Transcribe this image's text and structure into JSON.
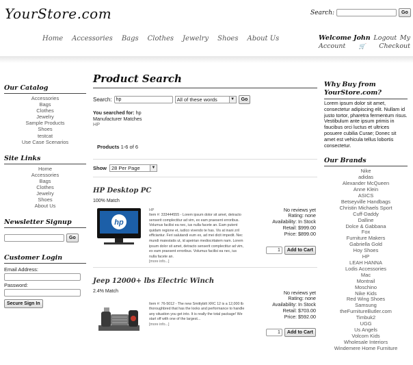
{
  "header": {
    "logo": "YourStore.com",
    "search_label": "Search:",
    "search_value": "",
    "go": "Go",
    "nav": [
      "Home",
      "Accessories",
      "Bags",
      "Clothes",
      "Jewelry",
      "Shoes",
      "About Us"
    ],
    "welcome": "Welcome John",
    "logout": "Logout",
    "my": "My",
    "account": "Account",
    "checkout": "Checkout"
  },
  "catalog": {
    "title": "Our Catalog",
    "items": [
      "Accessories",
      "Bags",
      "Clothes",
      "Jewelry",
      "Sample Products",
      "Shoes",
      "testcat",
      "Use Case Scenarios"
    ]
  },
  "sitelinks": {
    "title": "Site Links",
    "items": [
      "Home",
      "Accessories",
      "Bags",
      "Clothes",
      "Jewelry",
      "Shoes",
      "About Us"
    ]
  },
  "newsletter": {
    "title": "Newsletter Signup",
    "go": "Go"
  },
  "login": {
    "title": "Customer Login",
    "email_label": "Email Address:",
    "password_label": "Password:",
    "button": "Secure Sign In"
  },
  "main": {
    "title": "Product Search",
    "search_label": "Search:",
    "search_value": "hp",
    "mode": "All of these words",
    "go": "Go",
    "searched_label": "You searched for:",
    "searched_value": "hp",
    "manufacturer_label": "Manufacturer Matches",
    "manufacturer_value": "HP",
    "products_label": "Products",
    "products_range": "1-6 of 6",
    "show_label": "Show",
    "per_page": "28 Per Page"
  },
  "products": [
    {
      "name": "HP Desktop PC",
      "match": "100% Match",
      "brand": "HP",
      "desc": "Item #: 333444555 - Lorem ipsum dolor sit amet, detracto senserit complectitur ad vim, ex eam praesent erroribus. Volumus facilisi ea nec, ius nulla facete an. Eam putent quidam regione et, iudico vivendo te has. Vis at inani zril efficiantur. Feri salutandi eum ex, ad mei dicit impedit. Nec mundi maiestatis ut, id apeirian mediocritatem nam. Lorem ipsum dolor sit amet, detracto senserit complectitur ad vim, ex eam praesent erroribus. Volumus facilisi ea nec, ius nulla facete an.",
      "more": "[more info...]",
      "reviews": "No reviews yet",
      "rating": "Rating: none",
      "availability": "Availability: In Stock",
      "retail": "Retail: $999.00",
      "price": "Price: $899.00",
      "qty": "1",
      "add": "Add to Cart"
    },
    {
      "name": "Jeep 12000+ lbs Electric Winch",
      "match": "2.4% Match",
      "brand": "",
      "desc": "Item #: 76-5012 - The new Smittybilt XRC 12 is a 12,000 lb thoroughbred that has the looks and performance to handle any situation you get into. It is really the total package! We start off with one of the largest...",
      "more": "[more info...]",
      "reviews": "No reviews yet",
      "rating": "Rating: none",
      "availability": "Availability: In Stock",
      "retail": "Retail: $703.00",
      "price": "Price: $592.00",
      "qty": "1",
      "add": "Add to Cart"
    }
  ],
  "whybuy": {
    "title": "Why Buy from YourStore.com?",
    "text": "Lorem ipsum dolor sit amet, consectetur adipiscing elit. Nullam id justo tortor, pharetra fermentum risus. Vestibulum ante ipsum primis in faucibus orci luctus et ultrices posuere cubilia Curae; Donec sit amet est vehicula tellus lobortis consectetur."
  },
  "brands": {
    "title": "Our Brands",
    "items": [
      "Nike",
      "adidas",
      "Alexander McQueen",
      "Anne Klein",
      "ASICS",
      "Betseyville Handbags",
      "Christin Michaels Sport",
      "Cuff-Daddy",
      "Dalline",
      "Dolce & Gabbana",
      "Fox",
      "Furniture Makers",
      "Gabriella Gold",
      "Hoy Shoes",
      "HP",
      "LEAH HANNA",
      "Lodis Accessories",
      "Mac",
      "Montrail",
      "Moschino",
      "Nike Kids",
      "Red Wing Shoes",
      "Samsung",
      "theFurnitureButler.com",
      "Timbuk2",
      "UGG",
      "Us Angels",
      "Volcom Kids",
      "Wholesale Interiors",
      "Windemere Home Furniture"
    ]
  }
}
